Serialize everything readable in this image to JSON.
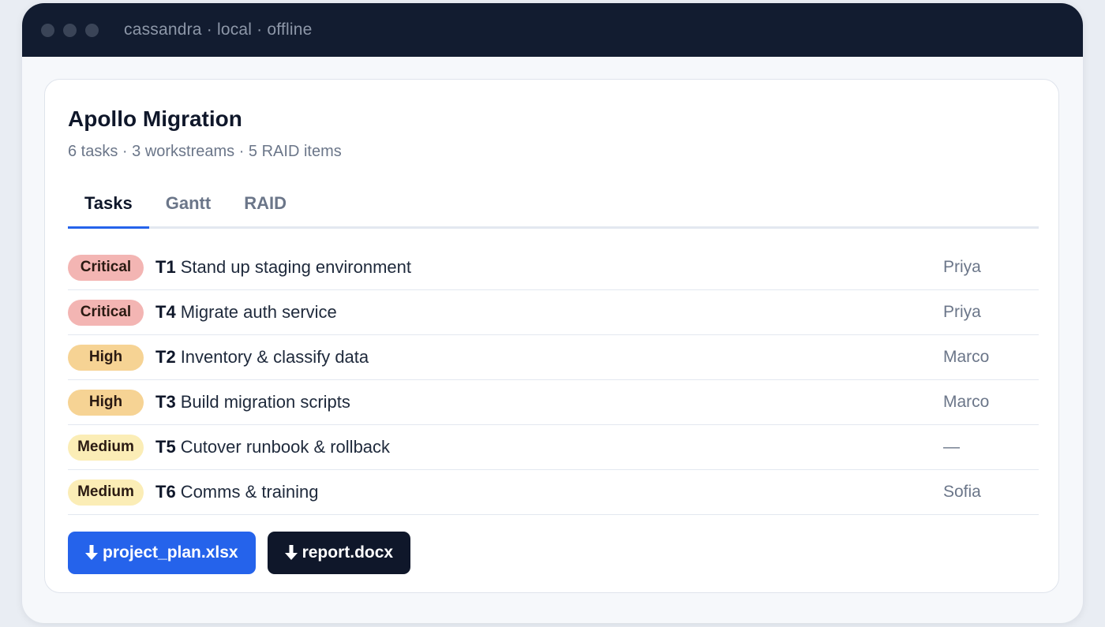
{
  "window": {
    "title": "cassandra · local · offline"
  },
  "project": {
    "title": "Apollo Migration",
    "summary": "6 tasks · 3 workstreams · 5 RAID items"
  },
  "tabs": [
    {
      "label": "Tasks",
      "active": true
    },
    {
      "label": "Gantt",
      "active": false
    },
    {
      "label": "RAID",
      "active": false
    }
  ],
  "tasks": [
    {
      "priority": "Critical",
      "id": "T1",
      "name": "Stand up staging environment",
      "assignee": "Priya"
    },
    {
      "priority": "Critical",
      "id": "T4",
      "name": "Migrate auth service",
      "assignee": "Priya"
    },
    {
      "priority": "High",
      "id": "T2",
      "name": "Inventory & classify data",
      "assignee": "Marco"
    },
    {
      "priority": "High",
      "id": "T3",
      "name": "Build migration scripts",
      "assignee": "Marco"
    },
    {
      "priority": "Medium",
      "id": "T5",
      "name": "Cutover runbook & rollback",
      "assignee": "—"
    },
    {
      "priority": "Medium",
      "id": "T6",
      "name": "Comms & training",
      "assignee": "Sofia"
    }
  ],
  "downloads": [
    {
      "label": "project_plan.xlsx",
      "icon": "download-icon"
    },
    {
      "label": "report.docx",
      "icon": "download-icon"
    }
  ],
  "colors": {
    "titlebar": "#121c30",
    "accent": "#2563eb",
    "critical": "#f3b5b3",
    "high": "#f6d394",
    "medium": "#fbedb6",
    "dark_button": "#0f172a"
  }
}
